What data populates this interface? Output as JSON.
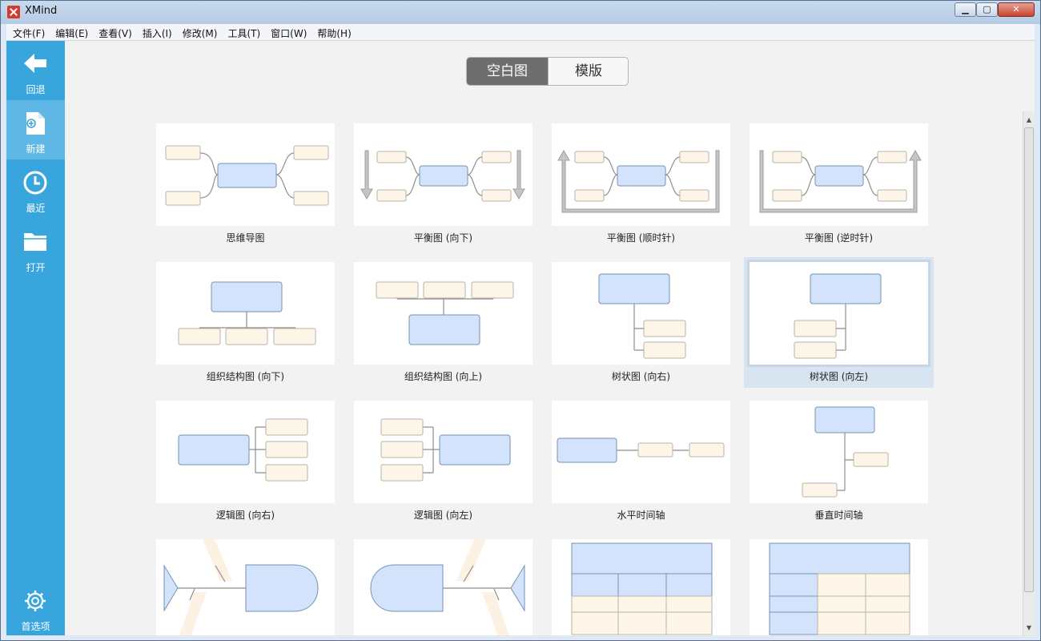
{
  "window": {
    "title": "XMind",
    "min_glyph": "▁",
    "max_glyph": "▢",
    "close_glyph": "✕"
  },
  "menu": [
    {
      "label": "文件(F)"
    },
    {
      "label": "编辑(E)"
    },
    {
      "label": "查看(V)"
    },
    {
      "label": "插入(I)"
    },
    {
      "label": "修改(M)"
    },
    {
      "label": "工具(T)"
    },
    {
      "label": "窗口(W)"
    },
    {
      "label": "帮助(H)"
    }
  ],
  "sidebar": {
    "items": [
      {
        "label": "回退",
        "icon": "back-arrow-icon"
      },
      {
        "label": "新建",
        "icon": "new-file-icon"
      },
      {
        "label": "最近",
        "icon": "clock-icon"
      },
      {
        "label": "打开",
        "icon": "folder-icon"
      }
    ],
    "bottom": {
      "label": "首选项",
      "icon": "gear-icon"
    }
  },
  "tabs": {
    "blank": "空白图",
    "template": "模版",
    "active": "blank"
  },
  "templates": [
    {
      "label": "思维导图",
      "kind": "mindmap"
    },
    {
      "label": "平衡图 (向下)",
      "kind": "balance-down"
    },
    {
      "label": "平衡图 (顺时针)",
      "kind": "balance-cw"
    },
    {
      "label": "平衡图 (逆时针)",
      "kind": "balance-ccw"
    },
    {
      "label": "组织结构图 (向下)",
      "kind": "org-down"
    },
    {
      "label": "组织结构图 (向上)",
      "kind": "org-up"
    },
    {
      "label": "树状图 (向右)",
      "kind": "tree-right"
    },
    {
      "label": "树状图 (向左)",
      "kind": "tree-left",
      "selected": true
    },
    {
      "label": "逻辑图 (向右)",
      "kind": "logic-right"
    },
    {
      "label": "逻辑图 (向左)",
      "kind": "logic-left"
    },
    {
      "label": "水平时间轴",
      "kind": "timeline-h"
    },
    {
      "label": "垂直时间轴",
      "kind": "timeline-v"
    },
    {
      "label": "",
      "kind": "fishbone-right"
    },
    {
      "label": "",
      "kind": "fishbone-left"
    },
    {
      "label": "",
      "kind": "matrix-columns"
    },
    {
      "label": "",
      "kind": "matrix-rows"
    }
  ],
  "colors": {
    "sidebar": "#38a5dd",
    "topic_fill": "#d2e3fb",
    "subtopic_fill": "#fdf5e7",
    "selected": "#d8e4f0"
  }
}
